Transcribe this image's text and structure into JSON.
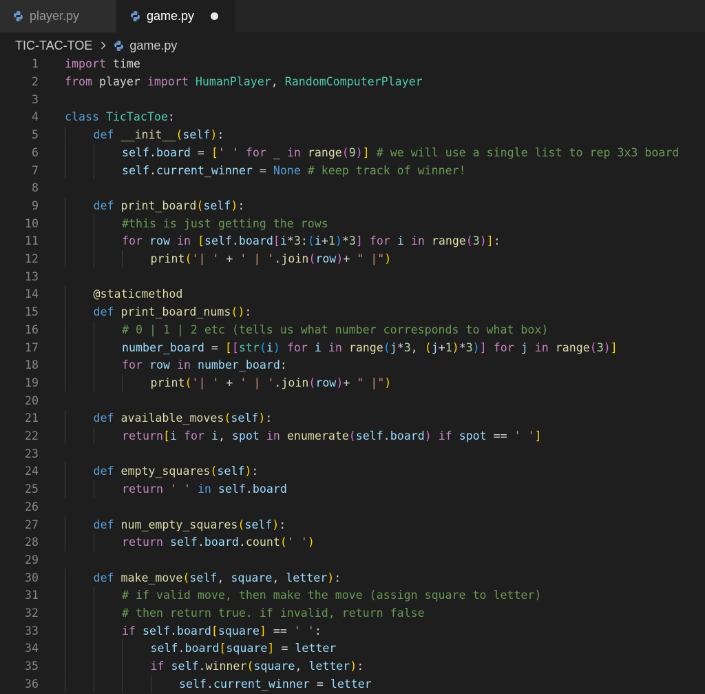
{
  "tabs": [
    {
      "label": "player.py",
      "active": false,
      "dirty": false
    },
    {
      "label": "game.py",
      "active": true,
      "dirty": true
    }
  ],
  "breadcrumb": {
    "folder": "TIC-TAC-TOE",
    "file": "game.py"
  },
  "icons": {
    "python_file": "python-file-icon",
    "unsaved": "unsaved-dot-icon",
    "chevron": "chevron-right-icon"
  },
  "colors": {
    "background": "#1e1e1e",
    "tabbar": "#252526",
    "keyword": "#c586c0",
    "storage": "#569cd6",
    "class_name": "#4ec9b0",
    "function": "#dcdcaa",
    "variable": "#9cdcfe",
    "string": "#ce9178",
    "number": "#b5cea8",
    "comment": "#6a9955"
  },
  "code_lines": [
    {
      "n": "1",
      "indent": 0,
      "tokens": [
        [
          "k",
          "import"
        ],
        [
          "p",
          " "
        ],
        [
          "p",
          "time"
        ]
      ]
    },
    {
      "n": "2",
      "indent": 0,
      "tokens": [
        [
          "k",
          "from"
        ],
        [
          "p",
          " player "
        ],
        [
          "k",
          "import"
        ],
        [
          "p",
          " "
        ],
        [
          "c",
          "HumanPlayer"
        ],
        [
          "p",
          ", "
        ],
        [
          "c",
          "RandomComputerPlayer"
        ]
      ]
    },
    {
      "n": "3",
      "indent": 0,
      "tokens": []
    },
    {
      "n": "4",
      "indent": 0,
      "tokens": [
        [
          "d",
          "class"
        ],
        [
          "p",
          " "
        ],
        [
          "c",
          "TicTacToe"
        ],
        [
          "p",
          ":"
        ]
      ]
    },
    {
      "n": "5",
      "indent": 1,
      "tokens": [
        [
          "d",
          "def"
        ],
        [
          "p",
          " "
        ],
        [
          "f",
          "__init__"
        ],
        [
          "y",
          "("
        ],
        [
          "v",
          "self"
        ],
        [
          "y",
          ")"
        ],
        [
          "p",
          ":"
        ]
      ]
    },
    {
      "n": "6",
      "indent": 2,
      "tokens": [
        [
          "v",
          "self"
        ],
        [
          "p",
          "."
        ],
        [
          "v",
          "board"
        ],
        [
          "p",
          " = "
        ],
        [
          "y",
          "["
        ],
        [
          "s",
          "' '"
        ],
        [
          "p",
          " "
        ],
        [
          "k",
          "for"
        ],
        [
          "p",
          " _ "
        ],
        [
          "k",
          "in"
        ],
        [
          "p",
          " "
        ],
        [
          "f",
          "range"
        ],
        [
          "b",
          "("
        ],
        [
          "n",
          "9"
        ],
        [
          "b",
          ")"
        ],
        [
          "y",
          "]"
        ],
        [
          "p",
          " "
        ],
        [
          "m",
          "# we will use a single list to rep 3x3 board"
        ]
      ]
    },
    {
      "n": "7",
      "indent": 2,
      "tokens": [
        [
          "v",
          "self"
        ],
        [
          "p",
          "."
        ],
        [
          "v",
          "current_winner"
        ],
        [
          "p",
          " = "
        ],
        [
          "d",
          "None"
        ],
        [
          "p",
          " "
        ],
        [
          "m",
          "# keep track of winner!"
        ]
      ]
    },
    {
      "n": "8",
      "indent": 0,
      "tokens": []
    },
    {
      "n": "9",
      "indent": 1,
      "tokens": [
        [
          "d",
          "def"
        ],
        [
          "p",
          " "
        ],
        [
          "f",
          "print_board"
        ],
        [
          "y",
          "("
        ],
        [
          "v",
          "self"
        ],
        [
          "y",
          ")"
        ],
        [
          "p",
          ":"
        ]
      ]
    },
    {
      "n": "10",
      "indent": 2,
      "tokens": [
        [
          "m",
          "#this is just getting the rows"
        ]
      ]
    },
    {
      "n": "11",
      "indent": 2,
      "tokens": [
        [
          "k",
          "for"
        ],
        [
          "p",
          " "
        ],
        [
          "v",
          "row"
        ],
        [
          "p",
          " "
        ],
        [
          "k",
          "in"
        ],
        [
          "p",
          " "
        ],
        [
          "y",
          "["
        ],
        [
          "v",
          "self"
        ],
        [
          "p",
          "."
        ],
        [
          "v",
          "board"
        ],
        [
          "b",
          "["
        ],
        [
          "v",
          "i"
        ],
        [
          "p",
          "*"
        ],
        [
          "n",
          "3"
        ],
        [
          "p",
          ":"
        ],
        [
          "u",
          "("
        ],
        [
          "v",
          "i"
        ],
        [
          "p",
          "+"
        ],
        [
          "n",
          "1"
        ],
        [
          "u",
          ")"
        ],
        [
          "p",
          "*"
        ],
        [
          "n",
          "3"
        ],
        [
          "b",
          "]"
        ],
        [
          "p",
          " "
        ],
        [
          "k",
          "for"
        ],
        [
          "p",
          " "
        ],
        [
          "v",
          "i"
        ],
        [
          "p",
          " "
        ],
        [
          "k",
          "in"
        ],
        [
          "p",
          " "
        ],
        [
          "f",
          "range"
        ],
        [
          "b",
          "("
        ],
        [
          "n",
          "3"
        ],
        [
          "b",
          ")"
        ],
        [
          "y",
          "]"
        ],
        [
          "p",
          ":"
        ]
      ]
    },
    {
      "n": "12",
      "indent": 3,
      "tokens": [
        [
          "f",
          "print"
        ],
        [
          "y",
          "("
        ],
        [
          "s",
          "'| '"
        ],
        [
          "p",
          " + "
        ],
        [
          "s",
          "' | '"
        ],
        [
          "p",
          "."
        ],
        [
          "f",
          "join"
        ],
        [
          "b",
          "("
        ],
        [
          "v",
          "row"
        ],
        [
          "b",
          ")"
        ],
        [
          "p",
          "+ "
        ],
        [
          "s",
          "\" |\""
        ],
        [
          "y",
          ")"
        ]
      ]
    },
    {
      "n": "13",
      "indent": 0,
      "tokens": []
    },
    {
      "n": "14",
      "indent": 1,
      "tokens": [
        [
          "f",
          "@staticmethod"
        ]
      ]
    },
    {
      "n": "15",
      "indent": 1,
      "tokens": [
        [
          "d",
          "def"
        ],
        [
          "p",
          " "
        ],
        [
          "f",
          "print_board_nums"
        ],
        [
          "y",
          "("
        ],
        [
          "y",
          ")"
        ],
        [
          "p",
          ":"
        ]
      ]
    },
    {
      "n": "16",
      "indent": 2,
      "tokens": [
        [
          "m",
          "# 0 | 1 | 2 etc (tells us what number corresponds to what box)"
        ]
      ]
    },
    {
      "n": "17",
      "indent": 2,
      "tokens": [
        [
          "v",
          "number_board"
        ],
        [
          "p",
          " = "
        ],
        [
          "y",
          "["
        ],
        [
          "b",
          "["
        ],
        [
          "c",
          "str"
        ],
        [
          "u",
          "("
        ],
        [
          "v",
          "i"
        ],
        [
          "u",
          ")"
        ],
        [
          "p",
          " "
        ],
        [
          "k",
          "for"
        ],
        [
          "p",
          " "
        ],
        [
          "v",
          "i"
        ],
        [
          "p",
          " "
        ],
        [
          "k",
          "in"
        ],
        [
          "p",
          " "
        ],
        [
          "f",
          "range"
        ],
        [
          "u",
          "("
        ],
        [
          "v",
          "j"
        ],
        [
          "p",
          "*"
        ],
        [
          "n",
          "3"
        ],
        [
          "p",
          ", "
        ],
        [
          "y",
          "("
        ],
        [
          "v",
          "j"
        ],
        [
          "p",
          "+"
        ],
        [
          "n",
          "1"
        ],
        [
          "y",
          ")"
        ],
        [
          "p",
          "*"
        ],
        [
          "n",
          "3"
        ],
        [
          "u",
          ")"
        ],
        [
          "b",
          "]"
        ],
        [
          "p",
          " "
        ],
        [
          "k",
          "for"
        ],
        [
          "p",
          " "
        ],
        [
          "v",
          "j"
        ],
        [
          "p",
          " "
        ],
        [
          "k",
          "in"
        ],
        [
          "p",
          " "
        ],
        [
          "f",
          "range"
        ],
        [
          "b",
          "("
        ],
        [
          "n",
          "3"
        ],
        [
          "b",
          ")"
        ],
        [
          "y",
          "]"
        ]
      ]
    },
    {
      "n": "18",
      "indent": 2,
      "tokens": [
        [
          "k",
          "for"
        ],
        [
          "p",
          " "
        ],
        [
          "v",
          "row"
        ],
        [
          "p",
          " "
        ],
        [
          "k",
          "in"
        ],
        [
          "p",
          " "
        ],
        [
          "v",
          "number_board"
        ],
        [
          "p",
          ":"
        ]
      ]
    },
    {
      "n": "19",
      "indent": 3,
      "tokens": [
        [
          "f",
          "print"
        ],
        [
          "y",
          "("
        ],
        [
          "s",
          "'| '"
        ],
        [
          "p",
          " + "
        ],
        [
          "s",
          "' | '"
        ],
        [
          "p",
          "."
        ],
        [
          "f",
          "join"
        ],
        [
          "b",
          "("
        ],
        [
          "v",
          "row"
        ],
        [
          "b",
          ")"
        ],
        [
          "p",
          "+ "
        ],
        [
          "s",
          "\" |\""
        ],
        [
          "y",
          ")"
        ]
      ]
    },
    {
      "n": "20",
      "indent": 0,
      "tokens": []
    },
    {
      "n": "21",
      "indent": 1,
      "tokens": [
        [
          "d",
          "def"
        ],
        [
          "p",
          " "
        ],
        [
          "f",
          "available_moves"
        ],
        [
          "y",
          "("
        ],
        [
          "v",
          "self"
        ],
        [
          "y",
          ")"
        ],
        [
          "p",
          ":"
        ]
      ]
    },
    {
      "n": "22",
      "indent": 2,
      "tokens": [
        [
          "k",
          "return"
        ],
        [
          "y",
          "["
        ],
        [
          "v",
          "i"
        ],
        [
          "p",
          " "
        ],
        [
          "k",
          "for"
        ],
        [
          "p",
          " "
        ],
        [
          "v",
          "i"
        ],
        [
          "p",
          ", "
        ],
        [
          "v",
          "spot"
        ],
        [
          "p",
          " "
        ],
        [
          "k",
          "in"
        ],
        [
          "p",
          " "
        ],
        [
          "f",
          "enumerate"
        ],
        [
          "b",
          "("
        ],
        [
          "v",
          "self"
        ],
        [
          "p",
          "."
        ],
        [
          "v",
          "board"
        ],
        [
          "b",
          ")"
        ],
        [
          "p",
          " "
        ],
        [
          "k",
          "if"
        ],
        [
          "p",
          " "
        ],
        [
          "v",
          "spot"
        ],
        [
          "p",
          " == "
        ],
        [
          "s",
          "' '"
        ],
        [
          "y",
          "]"
        ]
      ]
    },
    {
      "n": "23",
      "indent": 0,
      "tokens": []
    },
    {
      "n": "24",
      "indent": 1,
      "tokens": [
        [
          "d",
          "def"
        ],
        [
          "p",
          " "
        ],
        [
          "f",
          "empty_squares"
        ],
        [
          "y",
          "("
        ],
        [
          "v",
          "self"
        ],
        [
          "y",
          ")"
        ],
        [
          "p",
          ":"
        ]
      ]
    },
    {
      "n": "25",
      "indent": 2,
      "tokens": [
        [
          "k",
          "return"
        ],
        [
          "p",
          " "
        ],
        [
          "s",
          "' '"
        ],
        [
          "p",
          " "
        ],
        [
          "d",
          "in"
        ],
        [
          "p",
          " "
        ],
        [
          "v",
          "self"
        ],
        [
          "p",
          "."
        ],
        [
          "v",
          "board"
        ]
      ]
    },
    {
      "n": "26",
      "indent": 0,
      "tokens": []
    },
    {
      "n": "27",
      "indent": 1,
      "tokens": [
        [
          "d",
          "def"
        ],
        [
          "p",
          " "
        ],
        [
          "f",
          "num_empty_squares"
        ],
        [
          "y",
          "("
        ],
        [
          "v",
          "self"
        ],
        [
          "y",
          ")"
        ],
        [
          "p",
          ":"
        ]
      ]
    },
    {
      "n": "28",
      "indent": 2,
      "tokens": [
        [
          "k",
          "return"
        ],
        [
          "p",
          " "
        ],
        [
          "v",
          "self"
        ],
        [
          "p",
          "."
        ],
        [
          "v",
          "board"
        ],
        [
          "p",
          "."
        ],
        [
          "f",
          "count"
        ],
        [
          "y",
          "("
        ],
        [
          "s",
          "' '"
        ],
        [
          "y",
          ")"
        ]
      ]
    },
    {
      "n": "29",
      "indent": 0,
      "tokens": []
    },
    {
      "n": "30",
      "indent": 1,
      "tokens": [
        [
          "d",
          "def"
        ],
        [
          "p",
          " "
        ],
        [
          "f",
          "make_move"
        ],
        [
          "y",
          "("
        ],
        [
          "v",
          "self"
        ],
        [
          "p",
          ", "
        ],
        [
          "v",
          "square"
        ],
        [
          "p",
          ", "
        ],
        [
          "v",
          "letter"
        ],
        [
          "y",
          ")"
        ],
        [
          "p",
          ":"
        ]
      ]
    },
    {
      "n": "31",
      "indent": 2,
      "tokens": [
        [
          "m",
          "# if valid move, then make the move (assign square to letter)"
        ]
      ]
    },
    {
      "n": "32",
      "indent": 2,
      "tokens": [
        [
          "m",
          "# then return true. if invalid, return false"
        ]
      ]
    },
    {
      "n": "33",
      "indent": 2,
      "tokens": [
        [
          "k",
          "if"
        ],
        [
          "p",
          " "
        ],
        [
          "v",
          "self"
        ],
        [
          "p",
          "."
        ],
        [
          "v",
          "board"
        ],
        [
          "y",
          "["
        ],
        [
          "v",
          "square"
        ],
        [
          "y",
          "]"
        ],
        [
          "p",
          " == "
        ],
        [
          "s",
          "' '"
        ],
        [
          "p",
          ":"
        ]
      ]
    },
    {
      "n": "34",
      "indent": 3,
      "tokens": [
        [
          "v",
          "self"
        ],
        [
          "p",
          "."
        ],
        [
          "v",
          "board"
        ],
        [
          "y",
          "["
        ],
        [
          "v",
          "square"
        ],
        [
          "y",
          "]"
        ],
        [
          "p",
          " = "
        ],
        [
          "v",
          "letter"
        ]
      ]
    },
    {
      "n": "35",
      "indent": 3,
      "tokens": [
        [
          "k",
          "if"
        ],
        [
          "p",
          " "
        ],
        [
          "v",
          "self"
        ],
        [
          "p",
          "."
        ],
        [
          "f",
          "winner"
        ],
        [
          "y",
          "("
        ],
        [
          "v",
          "square"
        ],
        [
          "p",
          ", "
        ],
        [
          "v",
          "letter"
        ],
        [
          "y",
          ")"
        ],
        [
          "p",
          ":"
        ]
      ]
    },
    {
      "n": "36",
      "indent": 4,
      "tokens": [
        [
          "v",
          "self"
        ],
        [
          "p",
          "."
        ],
        [
          "v",
          "current_winner"
        ],
        [
          "p",
          " = "
        ],
        [
          "v",
          "letter"
        ]
      ]
    }
  ]
}
